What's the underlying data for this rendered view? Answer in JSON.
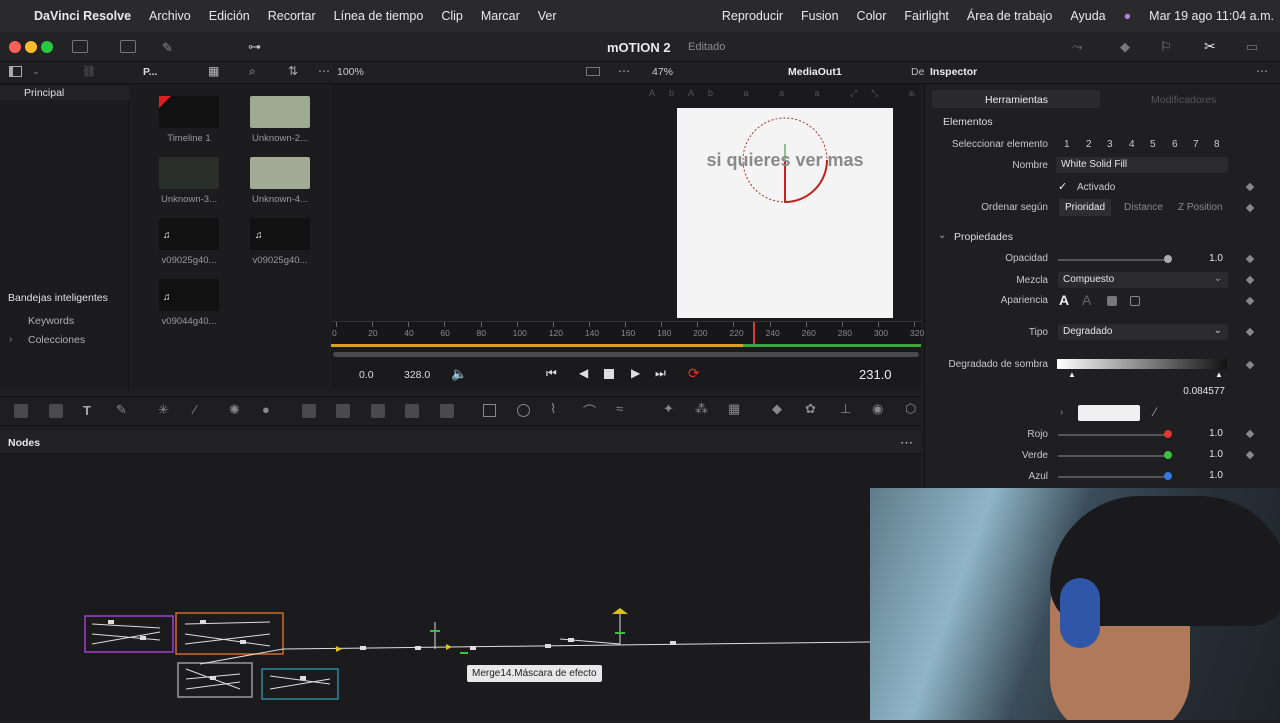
{
  "menubar": {
    "app_name": "DaVinci Resolve",
    "items": [
      "Archivo",
      "Edición",
      "Recortar",
      "Línea de tiempo",
      "Clip",
      "Marcar",
      "Ver"
    ],
    "right_items": [
      "Reproducir",
      "Fusion",
      "Color",
      "Fairlight",
      "Área de trabajo",
      "Ayuda"
    ],
    "datetime": "Mar 19 ago 11:04 a.m."
  },
  "titlebar": {
    "project": "mOTION 2",
    "status": "Editado"
  },
  "toolbar": {
    "zoom": "100%",
    "viewer_zoom": "47%",
    "viewer_node": "MediaOut1",
    "de_label": "De",
    "p_label": "P...",
    "inspector_label": "Inspector"
  },
  "left_panel": {
    "principal": "Principal",
    "smart_bins": "Bandejas inteligentes",
    "keywords": "Keywords",
    "collections": "Colecciones"
  },
  "media_pool": {
    "clips": [
      {
        "name": "Timeline 1",
        "icon": "timeline-icon"
      },
      {
        "name": "Unknown-2...",
        "icon": "image-icon"
      },
      {
        "name": "Unknown-3...",
        "icon": "image-icon"
      },
      {
        "name": "Unknown-4...",
        "icon": "image-icon"
      },
      {
        "name": "v09025g40...",
        "icon": "audio-icon"
      },
      {
        "name": "v09025g40...",
        "icon": "audio-icon"
      },
      {
        "name": "v09044g40...",
        "icon": "audio-icon"
      }
    ]
  },
  "viewer": {
    "canvas_text": "si quieres ver mas",
    "ruler_ticks": [
      "0",
      "20",
      "40",
      "60",
      "80",
      "100",
      "120",
      "140",
      "160",
      "180",
      "200",
      "220",
      "240",
      "260",
      "280",
      "300",
      "320"
    ],
    "playhead_frame": 231,
    "start_time": "0.0",
    "end_time": "328.0",
    "current_time": "231.0"
  },
  "nodes": {
    "header": "Nodes",
    "tooltip": "Merge14.Máscara de efecto"
  },
  "inspector": {
    "tabs": {
      "tools": "Herramientas",
      "modifiers": "Modificadores"
    },
    "elements_section": "Elementos",
    "select_element_label": "Seleccionar elemento",
    "select_element_options": [
      "1",
      "2",
      "3",
      "4",
      "5",
      "6",
      "7",
      "8"
    ],
    "name_label": "Nombre",
    "name_value": "White Solid Fill",
    "enabled_label": "Activado",
    "enabled": true,
    "sort_label": "Ordenar según",
    "sort_options": [
      "Prioridad",
      "Distance",
      "Z Position"
    ],
    "properties_section": "Propiedades",
    "opacity_label": "Opacidad",
    "opacity_value": "1.0",
    "blend_label": "Mezcla",
    "blend_value": "Compuesto",
    "appearance_label": "Apariencia",
    "type_label": "Tipo",
    "type_value": "Degradado",
    "shadow_gradient_label": "Degradado de sombra",
    "gradient_value": "0.084577",
    "red_label": "Rojo",
    "red_value": "1.0",
    "green_label": "Verde",
    "green_value": "1.0",
    "blue_label": "Azul",
    "blue_value": "1.0"
  },
  "colors": {
    "accent_red": "#e3342f",
    "accent_green": "#3fbf3f",
    "accent_blue": "#3477e3"
  }
}
